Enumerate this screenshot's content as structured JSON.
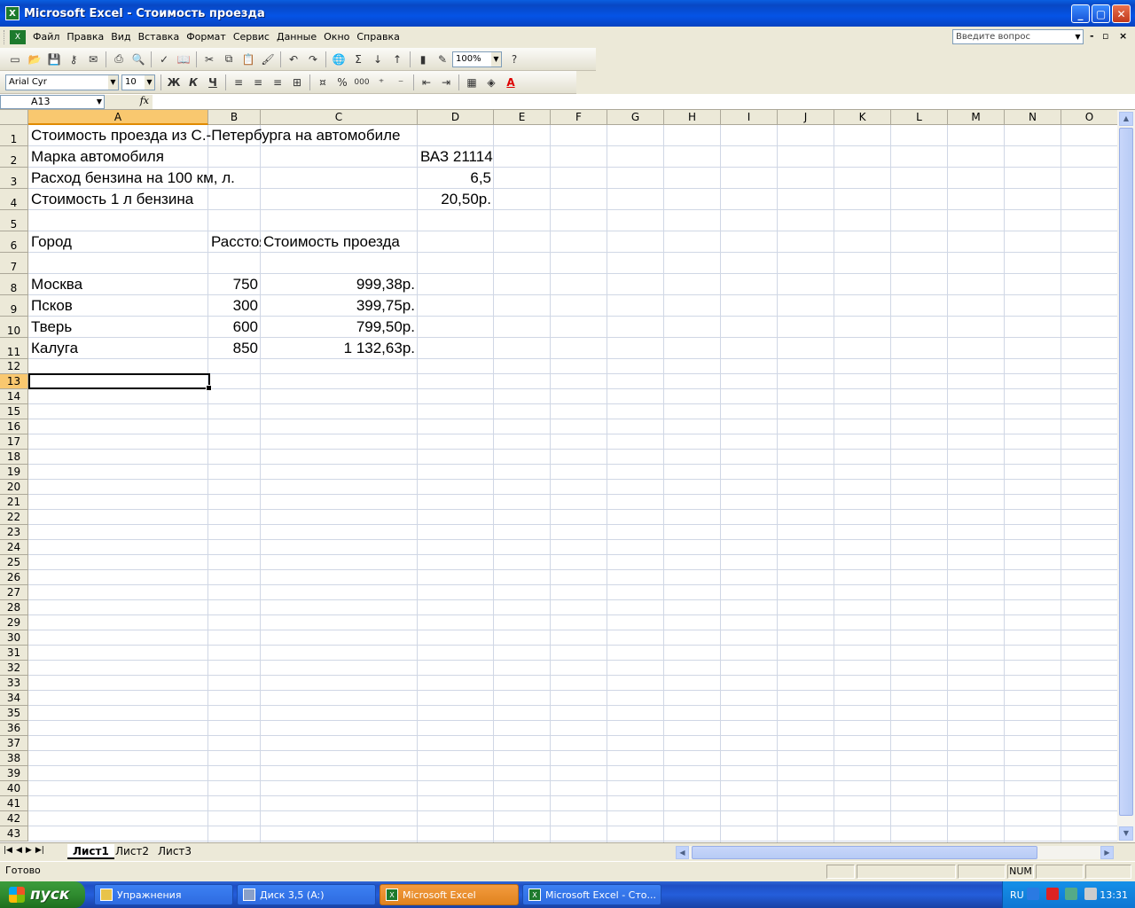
{
  "window": {
    "title": "Microsoft Excel - Стоимость проезда",
    "app_icon": "excel-icon",
    "controls": [
      "minimize-icon",
      "restore-icon",
      "close-icon"
    ]
  },
  "menubar": {
    "items": [
      "Файл",
      "Правка",
      "Вид",
      "Вставка",
      "Формат",
      "Сервис",
      "Данные",
      "Окно",
      "Справка"
    ],
    "help_placeholder": "Введите вопрос"
  },
  "toolbar_standard": {
    "zoom": "100%"
  },
  "toolbar_formatting": {
    "font_name": "Arial Cyr",
    "font_size": "10",
    "bold": "Ж",
    "italic": "К",
    "underline": "Ч",
    "percent": "%",
    "thousands": "000"
  },
  "formula_bar": {
    "name_box": "A13",
    "fx": "fx",
    "formula": ""
  },
  "sheet": {
    "columns": [
      "A",
      "B",
      "C",
      "D",
      "E",
      "F",
      "G",
      "H",
      "I",
      "J",
      "K",
      "L",
      "M",
      "N",
      "O"
    ],
    "selected_column": "A",
    "selected_row": "13",
    "rows": [
      "1",
      "2",
      "3",
      "4",
      "5",
      "6",
      "7",
      "8",
      "9",
      "10",
      "11",
      "12",
      "13",
      "14",
      "15",
      "16",
      "17",
      "18",
      "19",
      "20",
      "21",
      "22",
      "23",
      "24",
      "25",
      "26",
      "27",
      "28",
      "29",
      "30",
      "31",
      "32",
      "33",
      "34",
      "35",
      "36",
      "37",
      "38",
      "39",
      "40",
      "41",
      "42",
      "43"
    ],
    "cells": {
      "A1": "Стоимость проезда из С.-Петербурга на автомобиле",
      "A2": "Марка автомобиля",
      "D2": "ВАЗ 21114",
      "A3": "Расход бензина на 100 км, л.",
      "D3": "6,5",
      "A4": "Стоимость 1 л бензина",
      "D4": "20,50р.",
      "A6": "Город",
      "B6": "Расстояние",
      "C6": "Стоимость проезда",
      "A8": "Москва",
      "B8": "750",
      "C8": "999,38р.",
      "A9": "Псков",
      "B9": "300",
      "C9": "399,75р.",
      "A10": "Тверь",
      "B10": "600",
      "C10": "799,50р.",
      "A11": "Калуга",
      "B11": "850",
      "C11": "1 132,63р."
    }
  },
  "sheet_tabs": [
    "Лист1",
    "Лист2",
    "Лист3"
  ],
  "active_tab": "Лист1",
  "status": {
    "ready": "Готово",
    "num": "NUM"
  },
  "taskbar": {
    "start": "пуск",
    "buttons": [
      "Упражнения",
      "Диск 3,5 (A:)",
      "Microsoft Excel",
      "Microsoft Excel - Сто..."
    ],
    "lang": "RU",
    "clock": "13:31"
  }
}
